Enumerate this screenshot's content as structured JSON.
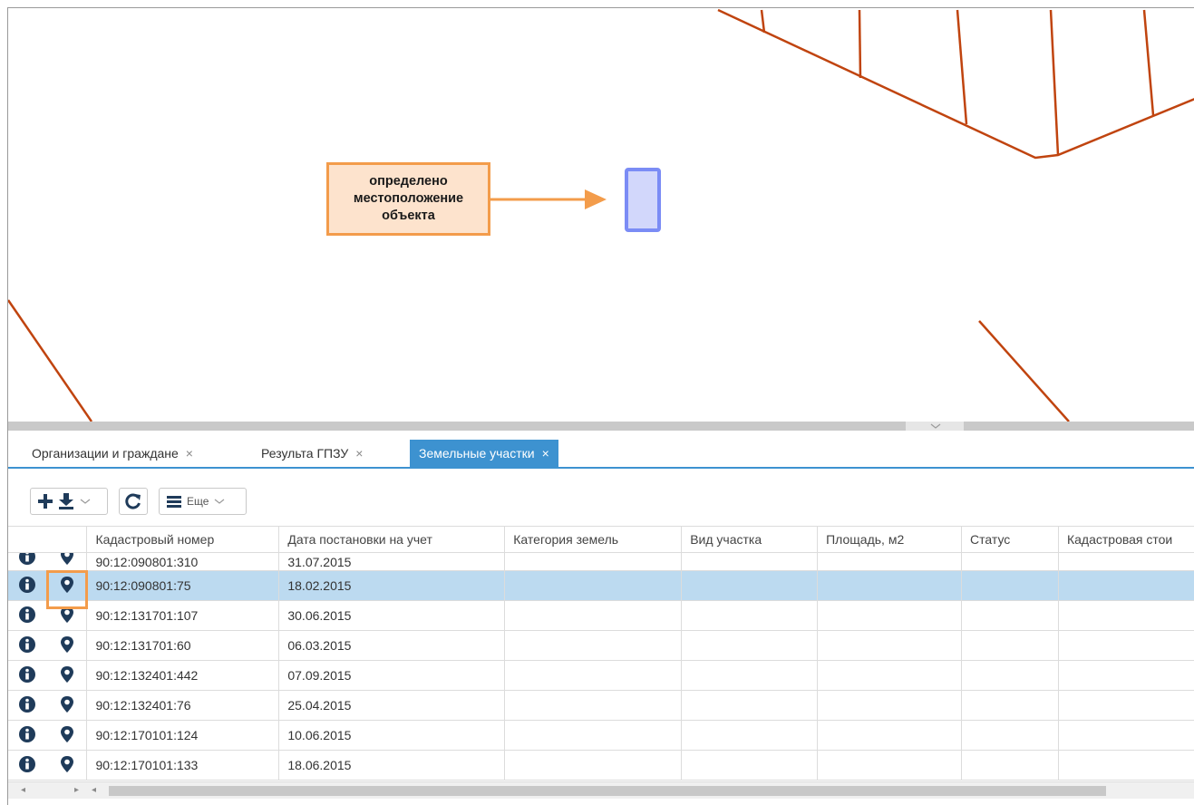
{
  "map": {
    "callout_text": "определено местоположение объекта",
    "line_color": "#c0440f",
    "object_color": "#7b8cf5"
  },
  "tabs": [
    {
      "label": "Организации и граждане",
      "close": "×",
      "active": false
    },
    {
      "label": "Результа ГПЗУ",
      "close": "×",
      "active": false
    },
    {
      "label": "Земельные участки",
      "close": "×",
      "active": true
    }
  ],
  "toolbar": {
    "add_icon": "plus-icon",
    "download_icon": "download-icon",
    "refresh_icon": "refresh-icon",
    "more_label": "Еще"
  },
  "grid": {
    "columns": [
      "Кадастровый номер",
      "Дата постановки на учет",
      "Категория земель",
      "Вид участка",
      "Площадь, м2",
      "Статус",
      "Кадастровая стои"
    ],
    "rows": [
      {
        "cadastral": "90:12:090801:310",
        "date": "31.07.2015",
        "selected": false
      },
      {
        "cadastral": "90:12:090801:75",
        "date": "18.02.2015",
        "selected": true
      },
      {
        "cadastral": "90:12:131701:107",
        "date": "30.06.2015",
        "selected": false
      },
      {
        "cadastral": "90:12:131701:60",
        "date": "06.03.2015",
        "selected": false
      },
      {
        "cadastral": "90:12:132401:442",
        "date": "07.09.2015",
        "selected": false
      },
      {
        "cadastral": "90:12:132401:76",
        "date": "25.04.2015",
        "selected": false
      },
      {
        "cadastral": "90:12:170101:124",
        "date": "10.06.2015",
        "selected": false
      },
      {
        "cadastral": "90:12:170101:133",
        "date": "18.06.2015",
        "selected": false
      }
    ]
  },
  "colors": {
    "accent": "#3d92d0",
    "selected_row": "#bcdaf0",
    "highlight": "#f39c4b",
    "callout_fill": "#fde3cd"
  }
}
